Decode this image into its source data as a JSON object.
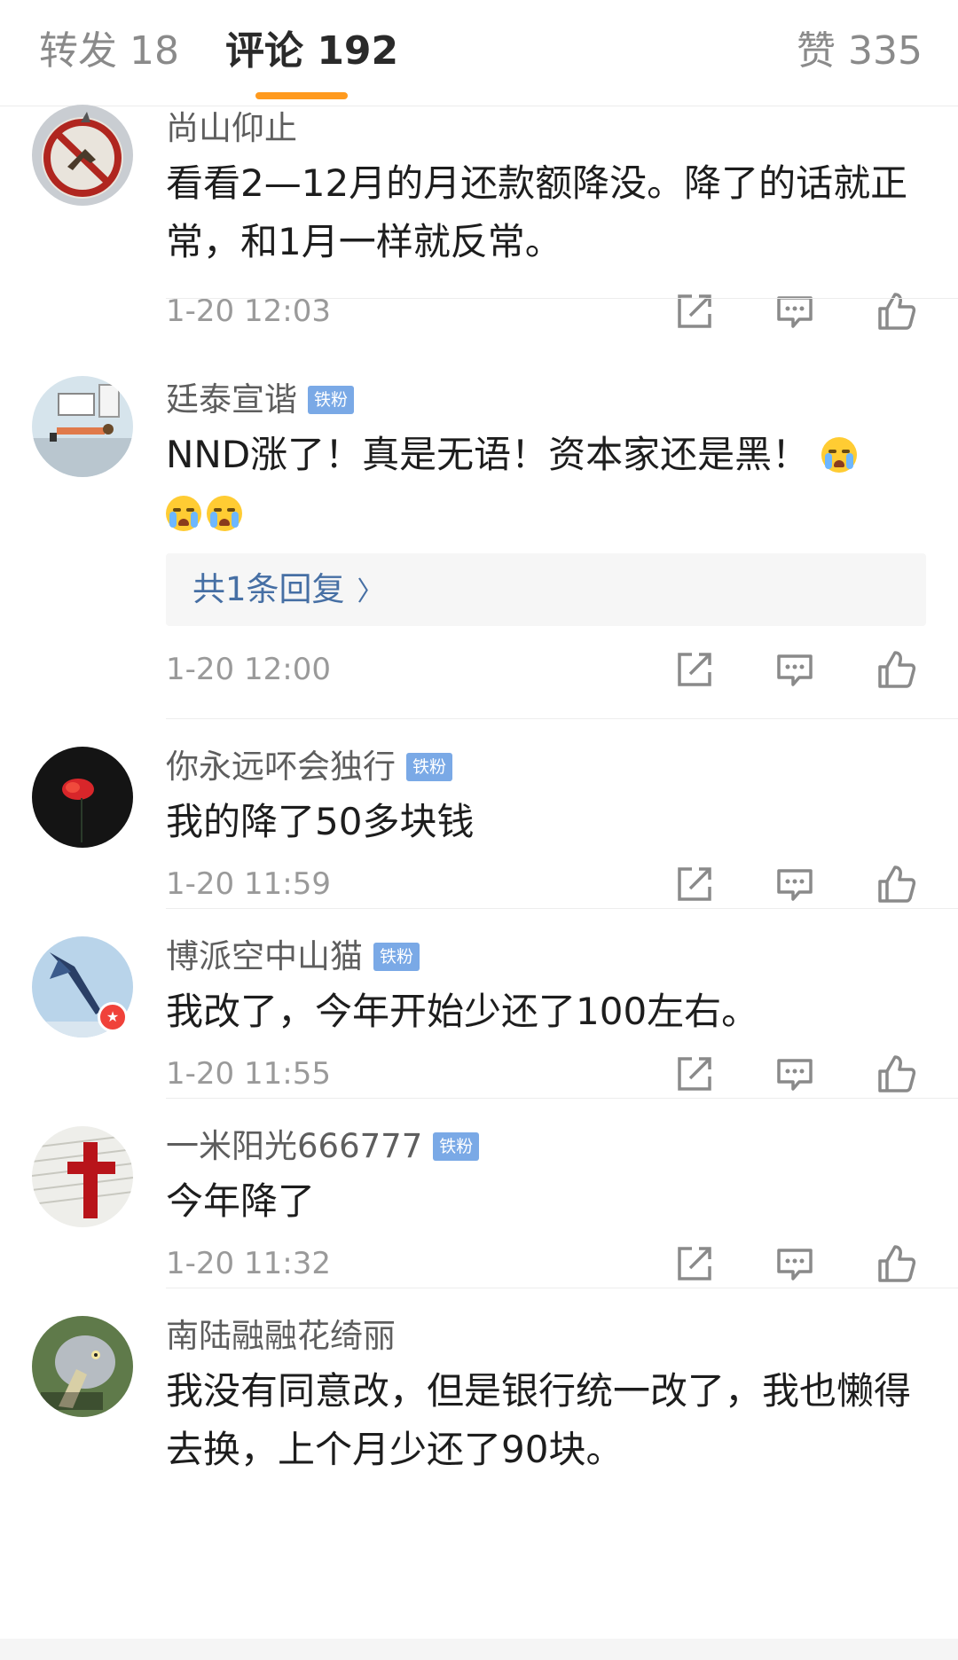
{
  "tabs": {
    "forward": "转发 18",
    "comments": "评论 192",
    "likes": "赞 335"
  },
  "accent_color": "#ff9a1e",
  "comments": [
    {
      "name": "尚山仰止",
      "badge": "",
      "text": "看看2—12月的月还款额降没。降了的话就正常，和1月一样就反常。",
      "time": "1-20 12:03"
    },
    {
      "name": "廷泰宣谐",
      "badge": "铁粉",
      "text": "NND涨了！真是无语！资本家还是黑！",
      "reply": "共1条回复",
      "time": "1-20 12:00"
    },
    {
      "name": "你永远吥会独行",
      "badge": "铁粉",
      "text": "我的降了50多块钱",
      "time": "1-20 11:59"
    },
    {
      "name": "博派空中山猫",
      "badge": "铁粉",
      "text": "我改了，今年开始少还了100左右。",
      "time": "1-20 11:55"
    },
    {
      "name": "一米阳光666777",
      "badge": "铁粉",
      "text": "今年降了",
      "time": "1-20 11:32"
    },
    {
      "name": "南陆融融花绮丽",
      "badge": "",
      "text": "我没有同意改，但是银行统一改了，我也懒得去换，上个月少还了90块。",
      "time": ""
    }
  ],
  "icons": {
    "share": "share-icon",
    "reply": "comment-icon",
    "like": "thumbs-up-icon",
    "emoji": "crying-emoji-icon"
  }
}
